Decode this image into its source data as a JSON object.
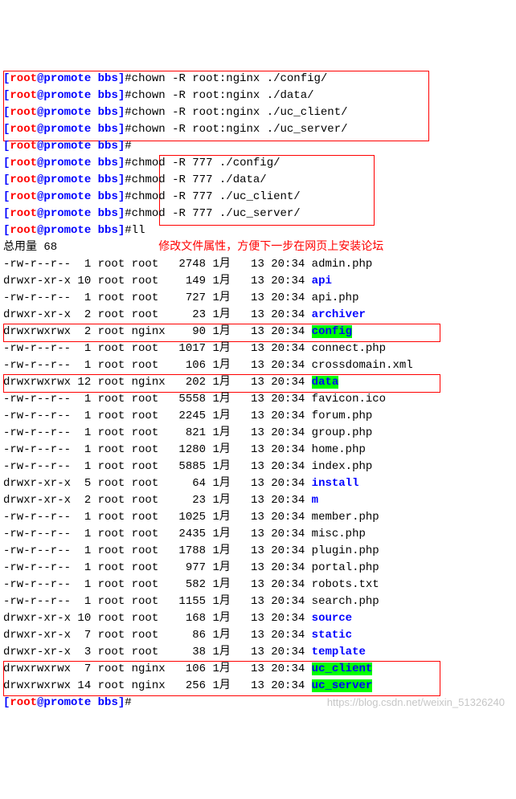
{
  "prompt": {
    "open": "[",
    "user": "root",
    "at": "@",
    "host": "promote",
    "dir": "bbs",
    "close": "]",
    "hash": "#"
  },
  "chown_cmds": [
    "chown -R root:nginx ./config/",
    "chown -R root:nginx ./data/",
    "chown -R root:nginx ./uc_client/",
    "chown -R root:nginx ./uc_server/"
  ],
  "chmod_cmds": [
    "chmod -R 777 ./config/",
    "chmod -R 777 ./data/",
    "chmod -R 777 ./uc_client/",
    "chmod -R 777 ./uc_server/"
  ],
  "ll_cmd": "ll",
  "total_line": "总用量 68",
  "annotation": "修改文件属性，方便下一步在网页上安装论坛",
  "listing": [
    {
      "perm": "-rw-r--r--",
      "links": "1",
      "user": "root",
      "group": "root",
      "size": "2748",
      "month": "1月",
      "day": "13",
      "time": "20:34",
      "name": "admin.php",
      "type": "file"
    },
    {
      "perm": "drwxr-xr-x",
      "links": "10",
      "user": "root",
      "group": "root",
      "size": "149",
      "month": "1月",
      "day": "13",
      "time": "20:34",
      "name": "api",
      "type": "dir"
    },
    {
      "perm": "-rw-r--r--",
      "links": "1",
      "user": "root",
      "group": "root",
      "size": "727",
      "month": "1月",
      "day": "13",
      "time": "20:34",
      "name": "api.php",
      "type": "file"
    },
    {
      "perm": "drwxr-xr-x",
      "links": "2",
      "user": "root",
      "group": "root",
      "size": "23",
      "month": "1月",
      "day": "13",
      "time": "20:34",
      "name": "archiver",
      "type": "dir"
    },
    {
      "perm": "drwxrwxrwx",
      "links": "2",
      "user": "root",
      "group": "nginx",
      "size": "90",
      "month": "1月",
      "day": "13",
      "time": "20:34",
      "name": "config",
      "type": "hl",
      "boxed": true
    },
    {
      "perm": "-rw-r--r--",
      "links": "1",
      "user": "root",
      "group": "root",
      "size": "1017",
      "month": "1月",
      "day": "13",
      "time": "20:34",
      "name": "connect.php",
      "type": "file"
    },
    {
      "perm": "-rw-r--r--",
      "links": "1",
      "user": "root",
      "group": "root",
      "size": "106",
      "month": "1月",
      "day": "13",
      "time": "20:34",
      "name": "crossdomain.xml",
      "type": "file"
    },
    {
      "perm": "drwxrwxrwx",
      "links": "12",
      "user": "root",
      "group": "nginx",
      "size": "202",
      "month": "1月",
      "day": "13",
      "time": "20:34",
      "name": "data",
      "type": "hl",
      "boxed": true
    },
    {
      "perm": "-rw-r--r--",
      "links": "1",
      "user": "root",
      "group": "root",
      "size": "5558",
      "month": "1月",
      "day": "13",
      "time": "20:34",
      "name": "favicon.ico",
      "type": "file"
    },
    {
      "perm": "-rw-r--r--",
      "links": "1",
      "user": "root",
      "group": "root",
      "size": "2245",
      "month": "1月",
      "day": "13",
      "time": "20:34",
      "name": "forum.php",
      "type": "file"
    },
    {
      "perm": "-rw-r--r--",
      "links": "1",
      "user": "root",
      "group": "root",
      "size": "821",
      "month": "1月",
      "day": "13",
      "time": "20:34",
      "name": "group.php",
      "type": "file"
    },
    {
      "perm": "-rw-r--r--",
      "links": "1",
      "user": "root",
      "group": "root",
      "size": "1280",
      "month": "1月",
      "day": "13",
      "time": "20:34",
      "name": "home.php",
      "type": "file"
    },
    {
      "perm": "-rw-r--r--",
      "links": "1",
      "user": "root",
      "group": "root",
      "size": "5885",
      "month": "1月",
      "day": "13",
      "time": "20:34",
      "name": "index.php",
      "type": "file"
    },
    {
      "perm": "drwxr-xr-x",
      "links": "5",
      "user": "root",
      "group": "root",
      "size": "64",
      "month": "1月",
      "day": "13",
      "time": "20:34",
      "name": "install",
      "type": "dir"
    },
    {
      "perm": "drwxr-xr-x",
      "links": "2",
      "user": "root",
      "group": "root",
      "size": "23",
      "month": "1月",
      "day": "13",
      "time": "20:34",
      "name": "m",
      "type": "dir"
    },
    {
      "perm": "-rw-r--r--",
      "links": "1",
      "user": "root",
      "group": "root",
      "size": "1025",
      "month": "1月",
      "day": "13",
      "time": "20:34",
      "name": "member.php",
      "type": "file"
    },
    {
      "perm": "-rw-r--r--",
      "links": "1",
      "user": "root",
      "group": "root",
      "size": "2435",
      "month": "1月",
      "day": "13",
      "time": "20:34",
      "name": "misc.php",
      "type": "file"
    },
    {
      "perm": "-rw-r--r--",
      "links": "1",
      "user": "root",
      "group": "root",
      "size": "1788",
      "month": "1月",
      "day": "13",
      "time": "20:34",
      "name": "plugin.php",
      "type": "file"
    },
    {
      "perm": "-rw-r--r--",
      "links": "1",
      "user": "root",
      "group": "root",
      "size": "977",
      "month": "1月",
      "day": "13",
      "time": "20:34",
      "name": "portal.php",
      "type": "file"
    },
    {
      "perm": "-rw-r--r--",
      "links": "1",
      "user": "root",
      "group": "root",
      "size": "582",
      "month": "1月",
      "day": "13",
      "time": "20:34",
      "name": "robots.txt",
      "type": "file"
    },
    {
      "perm": "-rw-r--r--",
      "links": "1",
      "user": "root",
      "group": "root",
      "size": "1155",
      "month": "1月",
      "day": "13",
      "time": "20:34",
      "name": "search.php",
      "type": "file"
    },
    {
      "perm": "drwxr-xr-x",
      "links": "10",
      "user": "root",
      "group": "root",
      "size": "168",
      "month": "1月",
      "day": "13",
      "time": "20:34",
      "name": "source",
      "type": "dir"
    },
    {
      "perm": "drwxr-xr-x",
      "links": "7",
      "user": "root",
      "group": "root",
      "size": "86",
      "month": "1月",
      "day": "13",
      "time": "20:34",
      "name": "static",
      "type": "dir"
    },
    {
      "perm": "drwxr-xr-x",
      "links": "3",
      "user": "root",
      "group": "root",
      "size": "38",
      "month": "1月",
      "day": "13",
      "time": "20:34",
      "name": "template",
      "type": "dir"
    },
    {
      "perm": "drwxrwxrwx",
      "links": "7",
      "user": "root",
      "group": "nginx",
      "size": "106",
      "month": "1月",
      "day": "13",
      "time": "20:34",
      "name": "uc_client",
      "type": "hl"
    },
    {
      "perm": "drwxrwxrwx",
      "links": "14",
      "user": "root",
      "group": "nginx",
      "size": "256",
      "month": "1月",
      "day": "13",
      "time": "20:34",
      "name": "uc_server",
      "type": "hl"
    }
  ],
  "watermark": "https://blog.csdn.net/weixin_51326240"
}
